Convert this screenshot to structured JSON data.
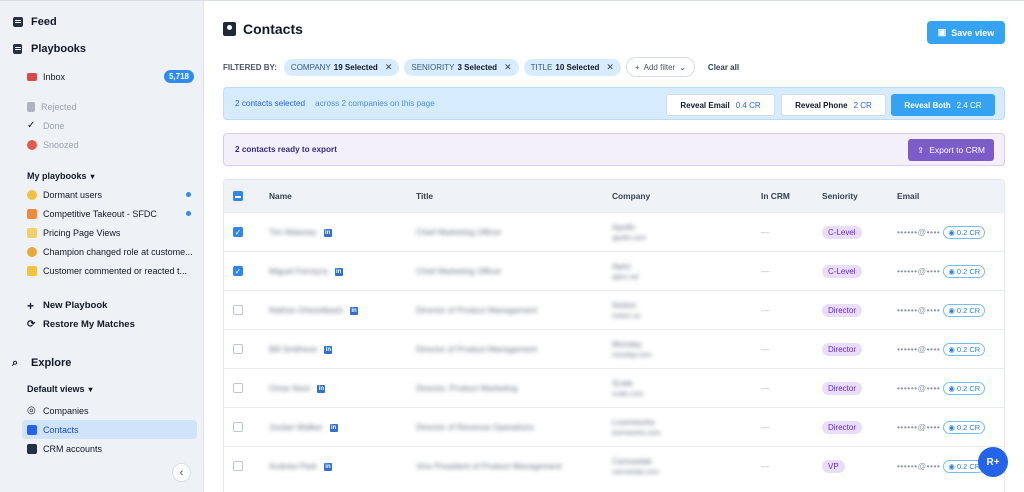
{
  "sidebar": {
    "feed": "Feed",
    "playbooks": "Playbooks",
    "inbox": {
      "label": "Inbox",
      "count": "5,718"
    },
    "status_items": [
      "Rejected",
      "Done",
      "Snoozed"
    ],
    "my_playbooks": "My playbooks",
    "playbook_items": [
      {
        "label": "Dormant users",
        "dot": true
      },
      {
        "label": "Competitive Takeout - SFDC",
        "dot": true
      },
      {
        "label": "Pricing Page Views",
        "dot": false
      },
      {
        "label": "Champion changed role at custome...",
        "dot": false
      },
      {
        "label": "Customer commented or reacted t...",
        "dot": false
      }
    ],
    "new_playbook": "New Playbook",
    "restore": "Restore My Matches",
    "explore": "Explore",
    "default_views": "Default views",
    "views": [
      "Companies",
      "Contacts",
      "CRM accounts"
    ]
  },
  "main": {
    "title": "Contacts",
    "save_view": "Save view",
    "filtered_by": "FILTERED BY:",
    "filters": [
      {
        "name": "COMPANY",
        "value": "19 Selected"
      },
      {
        "name": "SENIORITY",
        "value": "3 Selected"
      },
      {
        "name": "TITLE",
        "value": "10 Selected"
      }
    ],
    "add_filter": "Add filter",
    "clear_all": "Clear all",
    "selection": {
      "selected": "2 contacts selected",
      "detail": "across 2 companies on this page",
      "reveal_email": "Reveal Email",
      "reveal_email_cr": "0.4 CR",
      "reveal_phone": "Reveal Phone",
      "reveal_phone_cr": "2 CR",
      "reveal_both": "Reveal Both",
      "reveal_both_cr": "2.4 CR"
    },
    "export": {
      "text": "2 contacts ready to export",
      "button": "Export to CRM"
    },
    "columns": [
      "Name",
      "Title",
      "Company",
      "In CRM",
      "Seniority",
      "Email"
    ],
    "rows": [
      {
        "name": "Tim Maloney",
        "title": "Chief Marketing Officer",
        "company": "Apollo",
        "domain": "apollo.com",
        "crm": "—",
        "seniority": "C-Level",
        "email": "••••••@••••",
        "cr": "0.2 CR",
        "checked": true
      },
      {
        "name": "Miguel Ferreyra",
        "title": "Chief Marketing Officer",
        "company": "Apex",
        "domain": "apex.net",
        "crm": "—",
        "seniority": "C-Level",
        "email": "••••••@••••",
        "cr": "0.2 CR",
        "checked": true
      },
      {
        "name": "Nathan Ghezelbash",
        "title": "Director of Product Management",
        "company": "Notion",
        "domain": "notion.so",
        "crm": "—",
        "seniority": "Director",
        "email": "••••••@••••",
        "cr": "0.2 CR",
        "checked": false
      },
      {
        "name": "Bill Smithson",
        "title": "Director of Product Management",
        "company": "Monday",
        "domain": "monday.com",
        "crm": "—",
        "seniority": "Director",
        "email": "••••••@••••",
        "cr": "0.2 CR",
        "checked": false
      },
      {
        "name": "Omar Noor",
        "title": "Director, Product Marketing",
        "company": "Scale",
        "domain": "scale.com",
        "crm": "—",
        "seniority": "Director",
        "email": "••••••@••••",
        "cr": "0.2 CR",
        "checked": false
      },
      {
        "name": "Jordan Walker",
        "title": "Director of Revenue Operations",
        "company": "Loomworks",
        "domain": "loomworks.com",
        "crm": "—",
        "seniority": "Director",
        "email": "••••••@••••",
        "cr": "0.2 CR",
        "checked": false
      },
      {
        "name": "Andrew Park",
        "title": "Vice President of Product Management",
        "company": "Canvaslab",
        "domain": "canvaslab.com",
        "crm": "—",
        "seniority": "VP",
        "email": "••••••@••••",
        "cr": "0.2 CR",
        "checked": false
      }
    ],
    "fab": "R+"
  },
  "colors": {
    "accent": "#35a3f2",
    "purple": "#7c5cc8",
    "badge": "#2e8bf0"
  }
}
